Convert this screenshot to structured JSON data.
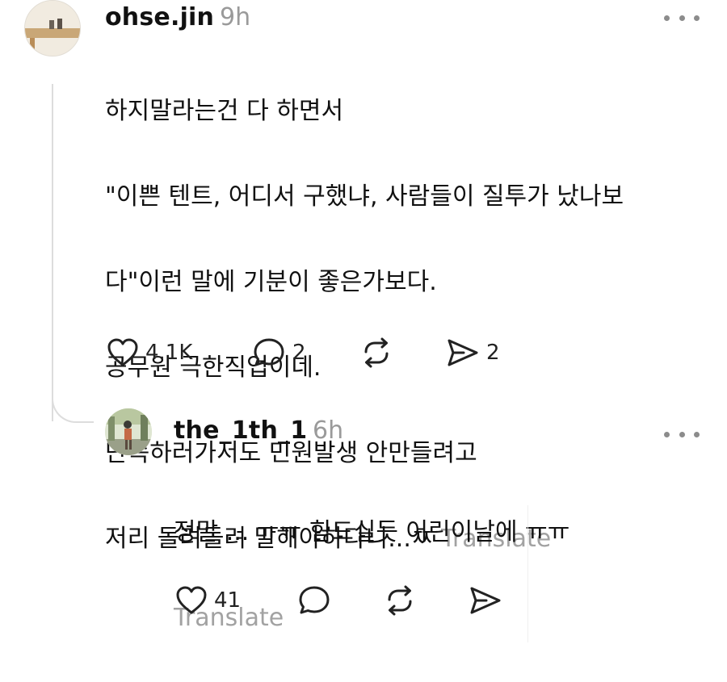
{
  "post": {
    "username": "ohse.jin",
    "time": "9h",
    "lines": [
      "하지말라는건 다 하면서",
      "\"이쁜 텐트, 어디서 구했냐, 사람들이 질투가 났나보",
      "다\"이런 말에 기분이 좋은가보다.",
      "공무원 극한직업이네.",
      "단속하러가서도 민원발생 안만들려고",
      "저리 돌려돌려 말해야하다니...ㅉ"
    ],
    "translate_label": "Translate",
    "likes": "4.1K",
    "comments": "2",
    "shares": "2"
  },
  "reply": {
    "username": "the_1th_1",
    "time": "6h",
    "text": "정말 ... ㅠㅠ 힘드실듯 어린이날에 ㅠㅠ",
    "translate_label": "Translate",
    "likes": "41"
  },
  "colors": {
    "text": "#111111",
    "muted": "#9a9a9a",
    "line": "#dddddd"
  },
  "icons": [
    "heart-icon",
    "comment-icon",
    "repost-icon",
    "send-icon",
    "more-icon"
  ]
}
